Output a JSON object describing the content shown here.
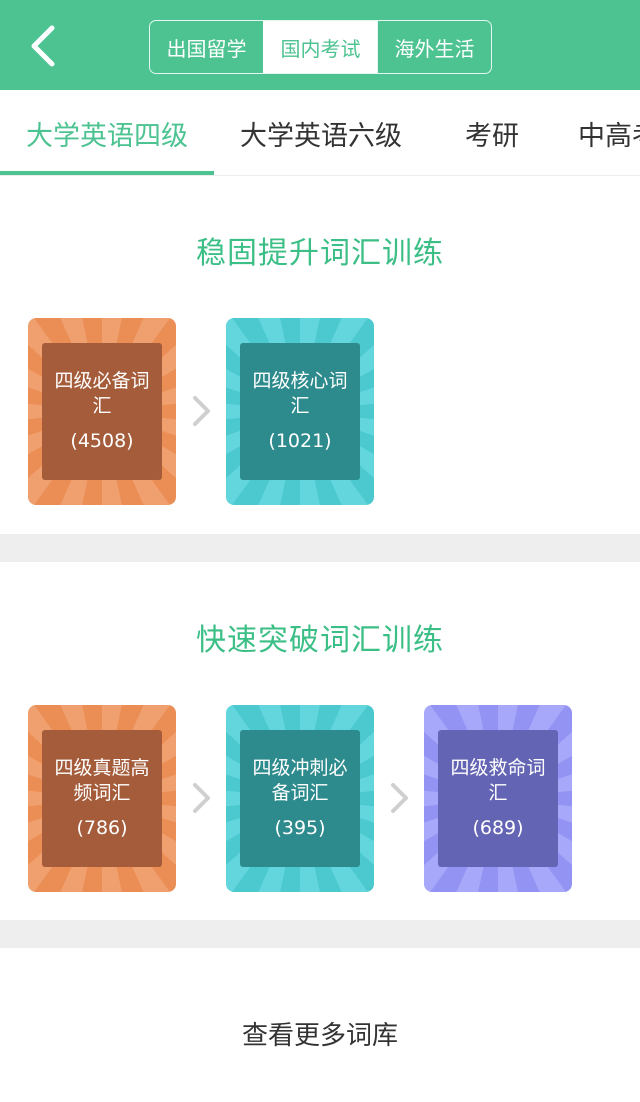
{
  "header": {
    "segments": [
      "出国留学",
      "国内考试",
      "海外生活"
    ],
    "active_segment": "国内考试",
    "accent_color": "#4cc391"
  },
  "categories": {
    "tabs": [
      "大学英语四级",
      "大学英语六级",
      "考研",
      "中高考"
    ],
    "active": "大学英语四级"
  },
  "sections": [
    {
      "title": "稳固提升词汇训练",
      "cards": [
        {
          "name": "四级必备词汇",
          "count": "(4508)",
          "color": "orange"
        },
        {
          "name": "四级核心词汇",
          "count": "(1021)",
          "color": "teal"
        }
      ]
    },
    {
      "title": "快速突破词汇训练",
      "cards": [
        {
          "name": "四级真题高频词汇",
          "count": "(786)",
          "color": "orange"
        },
        {
          "name": "四级冲刺必备词汇",
          "count": "(395)",
          "color": "teal"
        },
        {
          "name": "四级救命词汇",
          "count": "(689)",
          "color": "violet"
        }
      ]
    }
  ],
  "more_link": "查看更多词库"
}
